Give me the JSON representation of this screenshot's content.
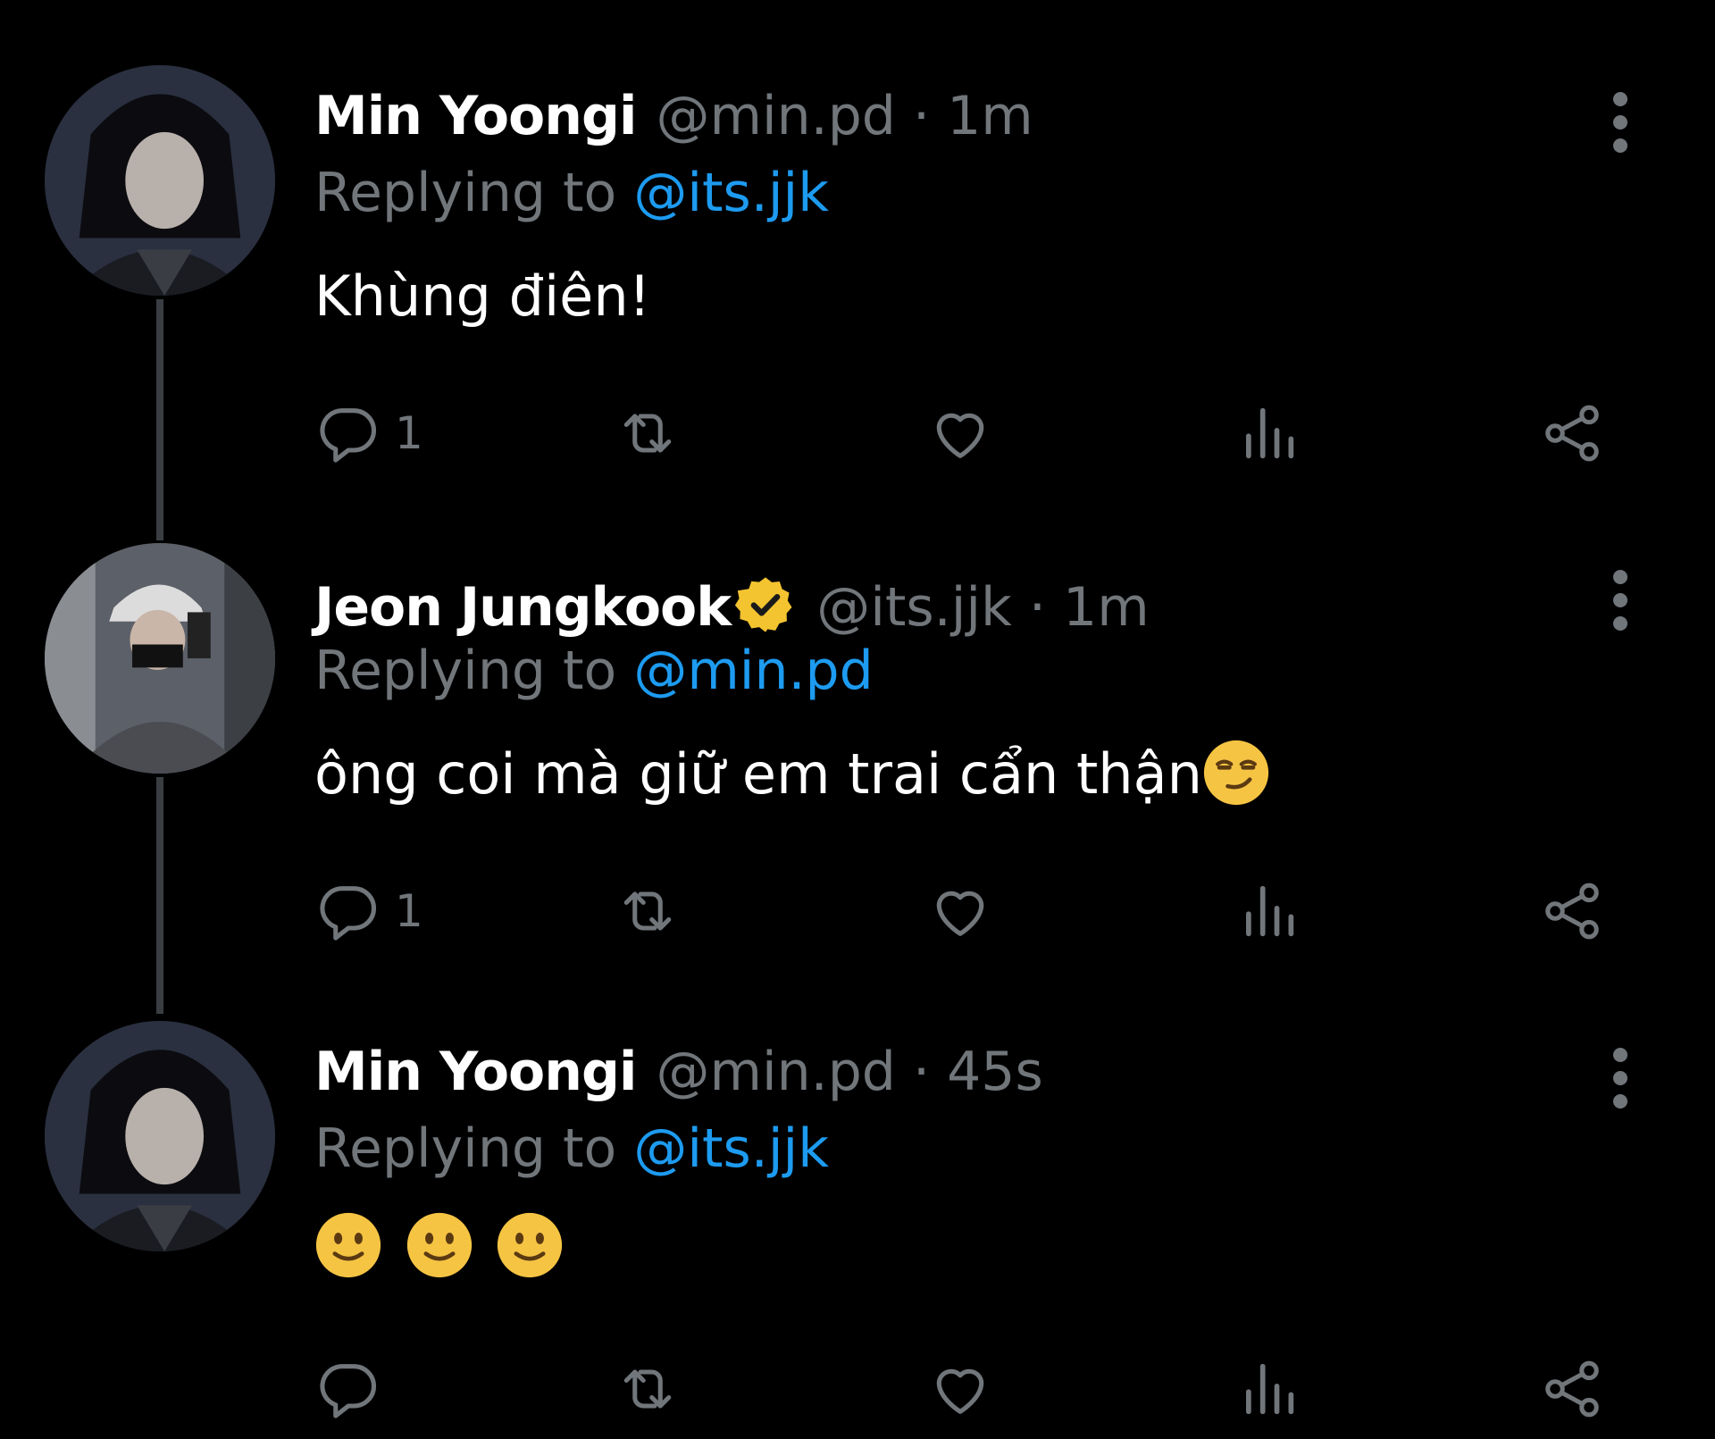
{
  "tweets": [
    {
      "name": "Min Yoongi",
      "handle_time": "@min.pd · 1m",
      "replying_prefix": "Replying to ",
      "replying_to": "@its.jjk",
      "text": "Khùng điên!",
      "reply_count": "1",
      "verified": false
    },
    {
      "name": "Jeon Jungkook",
      "handle_time": "@its.jjk · 1m",
      "replying_prefix": "Replying to ",
      "replying_to": "@min.pd",
      "text": "ông coi mà giữ em trai cẩn thận",
      "emoji": "smirking-face",
      "reply_count": "1",
      "verified": true
    },
    {
      "name": "Min Yoongi",
      "handle_time": "@min.pd · 45s",
      "replying_prefix": "Replying to ",
      "replying_to": "@its.jjk",
      "emojis": [
        "slightly-smiling-face",
        "slightly-smiling-face",
        "slightly-smiling-face"
      ],
      "reply_count": "",
      "verified": false
    }
  ],
  "colors": {
    "background": "#000000",
    "name": "#ffffff",
    "muted": "#71767b",
    "mention": "#1d9bf0",
    "verified_badge": "#f4c430",
    "thread_line": "#3a3d41"
  },
  "icons": [
    "reply-icon",
    "retweet-icon",
    "like-icon",
    "views-icon",
    "share-icon",
    "more-options-icon"
  ]
}
